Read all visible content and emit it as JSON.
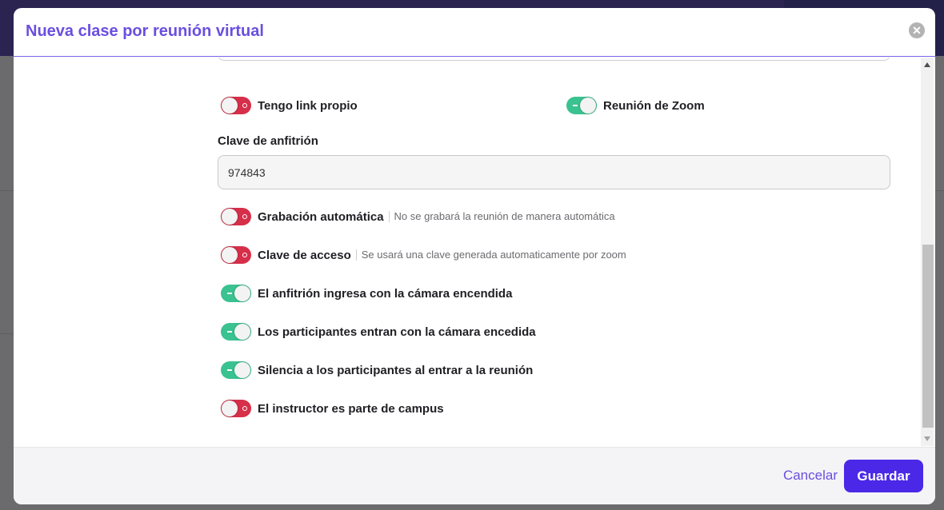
{
  "modal": {
    "title": "Nueva clase por reunión virtual",
    "close_icon": "close-icon"
  },
  "switches": {
    "own_link": {
      "label": "Tengo link propio",
      "on": false
    },
    "zoom_meeting": {
      "label": "Reunión de Zoom",
      "on": true
    }
  },
  "host_key": {
    "label": "Clave de anfitrión",
    "value": "974843"
  },
  "options": [
    {
      "label": "Grabación automática",
      "description": "No se grabará la reunión de manera automática",
      "on": false
    },
    {
      "label": "Clave de acceso",
      "description": "Se usará una clave generada automaticamente por zoom",
      "on": false
    },
    {
      "label": "El anfitrión ingresa con la cámara encendida",
      "description": "",
      "on": true
    },
    {
      "label": "Los participantes entran con la cámara encedida",
      "description": "",
      "on": true
    },
    {
      "label": "Silencia a los participantes al entrar a la reunión",
      "description": "",
      "on": true
    },
    {
      "label": "El instructor es parte de campus",
      "description": "",
      "on": false
    }
  ],
  "footer": {
    "cancel_label": "Cancelar",
    "save_label": "Guardar"
  },
  "colors": {
    "accent": "#4b28e8",
    "title": "#6a4fe0",
    "toggle_on": "#3ac290",
    "toggle_off": "#d62f4a"
  }
}
